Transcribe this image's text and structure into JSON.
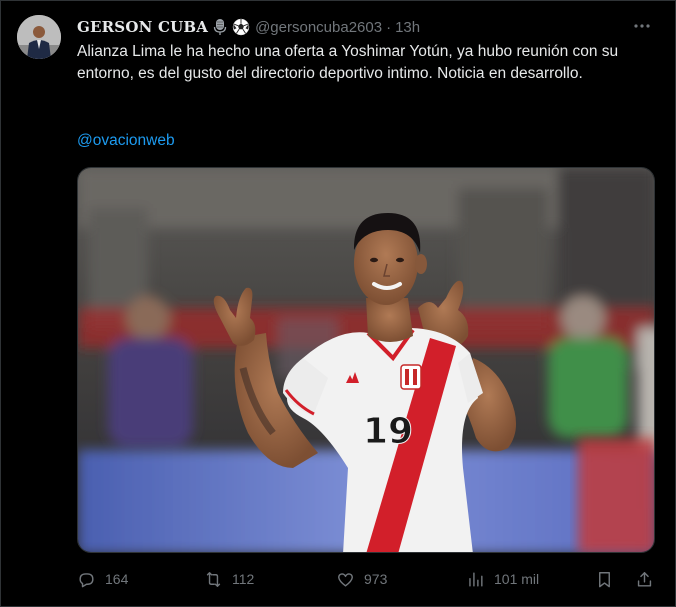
{
  "tweet": {
    "display_name": "GERSON CUBA",
    "name_emojis": [
      "microphone-icon",
      "soccer-ball-icon"
    ],
    "handle": "@gersoncuba2603",
    "separator": "·",
    "time": "13h",
    "text": "Alianza Lima le ha hecho una oferta a Yoshimar Yotún, ya hubo reunión con su entorno, es del gusto del directorio deportivo intimo. Noticia en desarrollo.",
    "mention": "@ovacionweb",
    "media": {
      "jersey_number": "19"
    }
  },
  "actions": {
    "replies": "164",
    "reposts": "112",
    "likes": "973",
    "views": "101 mil"
  },
  "colors": {
    "background": "#000000",
    "text": "#e7e9ea",
    "muted": "#71767b",
    "link": "#1d9bf0",
    "border": "#2f3336"
  }
}
